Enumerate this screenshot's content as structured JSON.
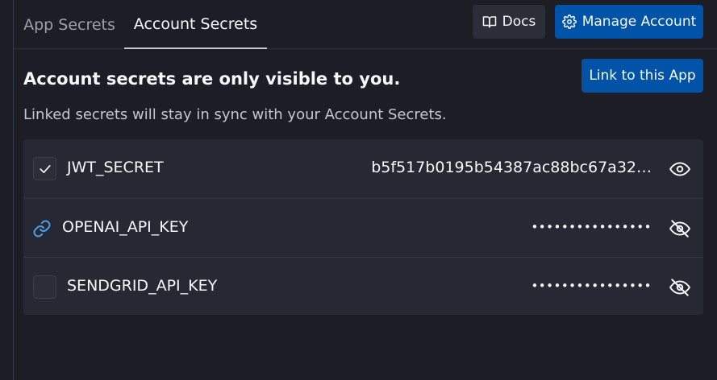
{
  "tabs": [
    {
      "label": "App Secrets",
      "active": false
    },
    {
      "label": "Account Secrets",
      "active": true
    }
  ],
  "header": {
    "docs_label": "Docs",
    "manage_label": "Manage Account"
  },
  "main": {
    "title": "Account secrets are only visible to you.",
    "subtitle": "Linked secrets will stay in sync with your Account Secrets.",
    "link_button_label": "Link to this App"
  },
  "secrets": [
    {
      "name": "JWT_SECRET",
      "value": "b5f517b0195b54387ac88bc67a32…",
      "state": "checked",
      "revealed": true
    },
    {
      "name": "OPENAI_API_KEY",
      "value": "••••••••••••••••",
      "state": "linked",
      "revealed": false
    },
    {
      "name": "SENDGRID_API_KEY",
      "value": "••••••••••••••••",
      "state": "unchecked",
      "revealed": false
    }
  ],
  "colors": {
    "background": "#1c1d25",
    "primary_button": "#0053a6",
    "secondary_button": "#2b2d38",
    "link_icon": "#4d9fe8"
  }
}
